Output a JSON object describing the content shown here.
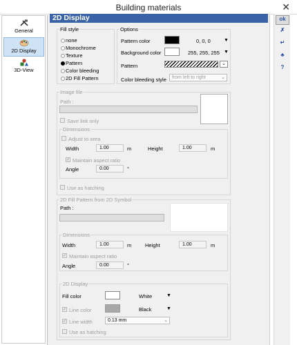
{
  "window": {
    "title": "Building materials",
    "close_symbol": "✕"
  },
  "nav": {
    "items": [
      {
        "label": "General"
      },
      {
        "label": "2D Display"
      },
      {
        "label": "3D-View"
      }
    ]
  },
  "header": {
    "title": "2D Display"
  },
  "right_toolbar": {
    "ok": "ok",
    "b2": "✗",
    "b3": "↵",
    "b4": "♣",
    "b5": "?"
  },
  "fill_style": {
    "title": "Fill style",
    "options": [
      "none",
      "Monochrome",
      "Texture",
      "Pattern",
      "Color bleeding",
      "2D Fill Pattern"
    ],
    "selected": "Pattern"
  },
  "options": {
    "title": "Options",
    "pattern_color_label": "Pattern color",
    "pattern_color_value": "0, 0, 0",
    "pattern_color_hex": "#000000",
    "background_color_label": "Background color",
    "background_color_value": "255, 255, 255",
    "background_color_hex": "#ffffff",
    "pattern_label": "Pattern",
    "color_bleeding_style_label": "Color bleeding style",
    "color_bleeding_style_value": "from left to right"
  },
  "image_file": {
    "title": "Image file",
    "path_label": "Path :",
    "save_link_only": "Save link only",
    "dimensions_title": "Dimensions",
    "adjust_to_area": "Adjust to area",
    "width_label": "Width",
    "width_value": "1.00",
    "width_unit": "m",
    "height_label": "Height",
    "height_value": "1.00",
    "height_unit": "m",
    "maintain_aspect_ratio": "Maintain aspect ratio",
    "angle_label": "Angle",
    "angle_value": "0.00",
    "angle_unit": "°",
    "use_as_hatching": "Use as hatching"
  },
  "fill_pattern_2d": {
    "title": "2D Fill Pattern from 2D Symbol",
    "path_label": "Path :",
    "dimensions_title": "Dimensions",
    "width_label": "Width",
    "width_value": "1.00",
    "width_unit": "m",
    "height_label": "Height",
    "height_value": "1.00",
    "height_unit": "m",
    "maintain_aspect_ratio": "Maintain aspect ratio",
    "angle_label": "Angle",
    "angle_value": "0.00",
    "angle_unit": "°",
    "display_title": "2D Display",
    "fill_color_label": "Fill color",
    "fill_color_value": "White",
    "fill_color_hex": "#ffffff",
    "line_color_label": "Line color",
    "line_color_value": "Black",
    "line_color_hex": "#a8a8a8",
    "line_width_label": "Line width",
    "line_width_value": "0.13 mm",
    "use_as_hatching": "Use as hatching"
  },
  "colors": {
    "header_bg": "#3a62a6",
    "nav_selected_bg": "#cfe3f7",
    "ok_text": "#2b4f9e"
  }
}
